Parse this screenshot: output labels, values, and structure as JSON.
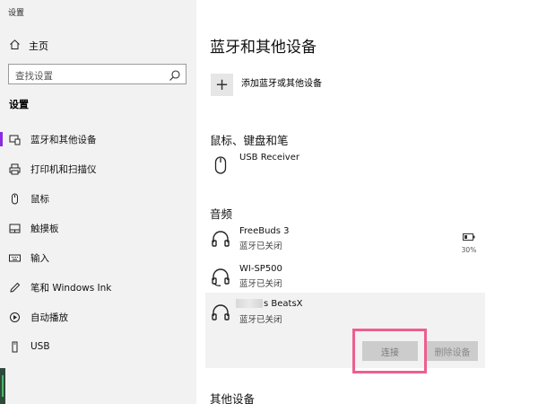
{
  "window": {
    "title": "设置"
  },
  "sidebar": {
    "home_label": "主页",
    "search_placeholder": "查找设置",
    "section_title": "设置",
    "items": [
      {
        "label": "蓝牙和其他设备",
        "icon": "bluetooth-devices-icon",
        "active": true
      },
      {
        "label": "打印机和扫描仪",
        "icon": "printer-icon"
      },
      {
        "label": "鼠标",
        "icon": "mouse-icon"
      },
      {
        "label": "触摸板",
        "icon": "touchpad-icon"
      },
      {
        "label": "输入",
        "icon": "keyboard-icon"
      },
      {
        "label": "笔和 Windows Ink",
        "icon": "pen-icon"
      },
      {
        "label": "自动播放",
        "icon": "autoplay-icon"
      },
      {
        "label": "USB",
        "icon": "usb-icon"
      }
    ]
  },
  "main": {
    "title": "蓝牙和其他设备",
    "add_device_label": "添加蓝牙或其他设备",
    "groups": {
      "input": {
        "title": "鼠标、键盘和笔",
        "devices": [
          {
            "name": "USB Receiver",
            "icon": "mouse-icon"
          }
        ]
      },
      "audio": {
        "title": "音频",
        "devices": [
          {
            "name": "FreeBuds 3",
            "status": "蓝牙已关闭",
            "battery": "30%",
            "icon": "headphones-icon"
          },
          {
            "name": "WI-SP500",
            "status": "蓝牙已关闭",
            "icon": "headset-icon"
          },
          {
            "name": "s BeatsX",
            "status": "蓝牙已关闭",
            "icon": "headphones-icon",
            "selected": true
          }
        ]
      },
      "other": {
        "title": "其他设备"
      }
    },
    "buttons": {
      "connect": "连接",
      "remove": "删除设备"
    }
  },
  "colors": {
    "accent": "#8a2be2",
    "highlight": "#ec5f8e"
  }
}
